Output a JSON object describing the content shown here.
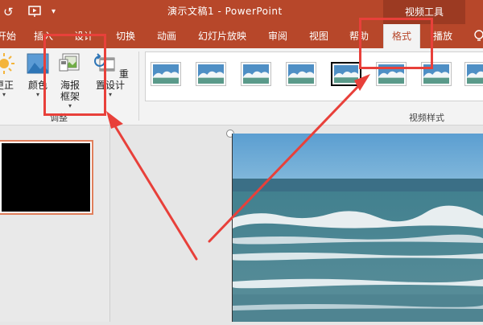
{
  "titlebar": {
    "title": "演示文稿1 - PowerPoint",
    "context_tools": "视频工具",
    "icons": [
      "undo-icon",
      "slideshow-from-start-icon",
      "customize-qat-icon"
    ]
  },
  "tabs": [
    {
      "label": "开始"
    },
    {
      "label": "插入"
    },
    {
      "label": "设计"
    },
    {
      "label": "切换"
    },
    {
      "label": "动画"
    },
    {
      "label": "幻灯片放映"
    },
    {
      "label": "审阅"
    },
    {
      "label": "视图"
    },
    {
      "label": "帮助"
    },
    {
      "label": "格式",
      "active": true
    },
    {
      "label": "播放"
    }
  ],
  "ribbon": {
    "adjust": {
      "correct_label": "更正",
      "color_label": "颜色",
      "poster_frame_label": "海报框架",
      "reset_design_label": "重置设计",
      "group_label": "调整"
    },
    "video_styles": {
      "group_label": "视频样式",
      "selected_index": 6,
      "count": 9
    }
  },
  "colors": {
    "accent": "#b7472a",
    "annotation": "#e8403a"
  }
}
